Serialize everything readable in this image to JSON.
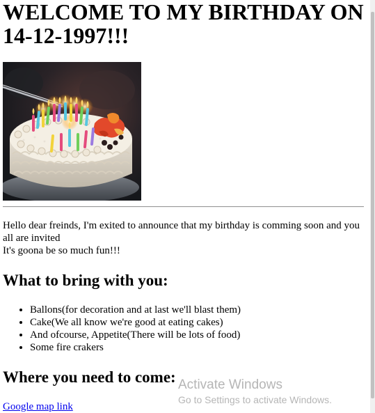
{
  "page": {
    "title": "WELCOME TO MY BIRTHDAY ON 14-12-1997!!!",
    "hero_image_icon": "birthday-cake-image"
  },
  "intro": {
    "line1": "Hello dear freinds, I'm exited to announce that my birthday is comming soon and you all are invited",
    "line2": "It's goona be so much fun!!!"
  },
  "bring": {
    "heading": "What to bring with you:",
    "items": [
      "Ballons(for decoration and at last we'll blast them)",
      "Cake(We all know we're good at eating cakes)",
      "And ofcourse, Appetite(There will be lots of food)",
      "Some fire crakers"
    ]
  },
  "where": {
    "heading": "Where you need to come:",
    "link_label": "Google map link"
  },
  "watermark": {
    "title": "Activate Windows",
    "subtitle": "Go to Settings to activate Windows."
  },
  "colors": {
    "link": "#0000ee",
    "text": "#000000",
    "divider": "#9a9a9a"
  }
}
